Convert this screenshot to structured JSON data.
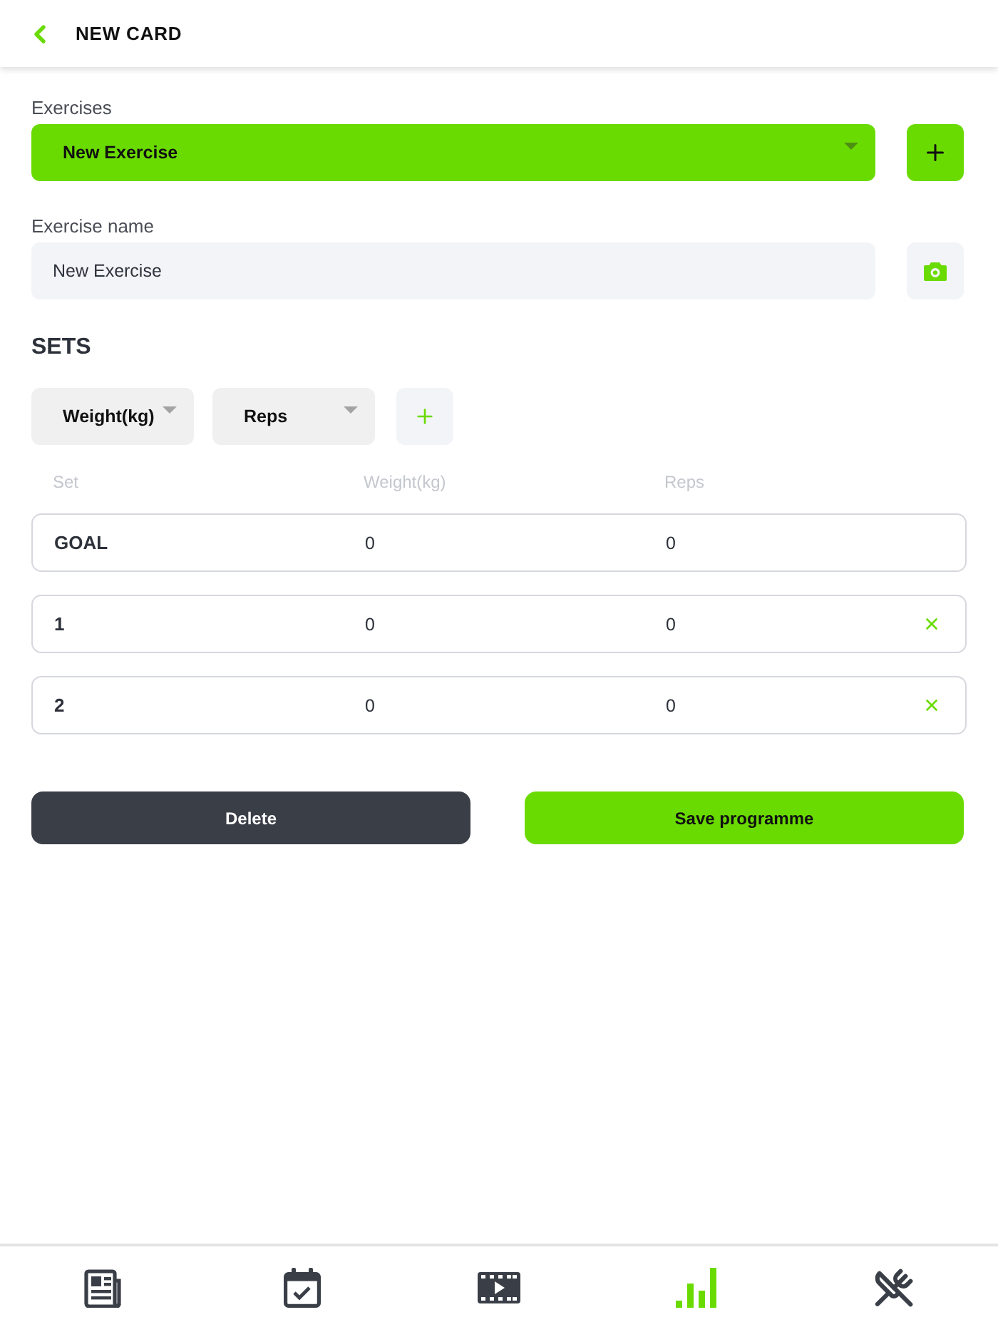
{
  "header": {
    "title": "NEW CARD"
  },
  "exercises": {
    "label": "Exercises",
    "value": "New Exercise"
  },
  "exercise_name": {
    "label": "Exercise name",
    "value": "New Exercise"
  },
  "sets": {
    "title": "SETS",
    "column_pickers": [
      "Weight(kg)",
      "Reps"
    ],
    "columns": [
      "Set",
      "Weight(kg)",
      "Reps"
    ],
    "rows": [
      {
        "kind": "goal",
        "cells": [
          "GOAL",
          "0",
          "0"
        ]
      },
      {
        "kind": "set",
        "cells": [
          "1",
          "0",
          "0"
        ]
      },
      {
        "kind": "set",
        "cells": [
          "2",
          "0",
          "0"
        ]
      }
    ]
  },
  "actions": [
    {
      "kind": "secondary",
      "label": "Delete"
    },
    {
      "kind": "primary",
      "label": "Save programme"
    }
  ],
  "tab_bar": [
    {
      "selected": false
    },
    {
      "selected": false
    },
    {
      "selected": false
    },
    {
      "selected": true
    },
    {
      "selected": false
    }
  ]
}
